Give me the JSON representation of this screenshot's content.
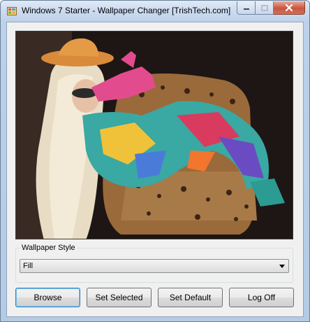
{
  "window": {
    "title": "Windows 7 Starter - Wallpaper Changer [TrishTech.com]"
  },
  "preview": {
    "alt": "Wallpaper preview"
  },
  "style_group": {
    "label": "Wallpaper Style",
    "selected": "Fill"
  },
  "buttons": {
    "browse": "Browse",
    "set_selected": "Set Selected",
    "set_default": "Set Default",
    "log_off": "Log Off"
  },
  "colors": {
    "accent": "#3c7fb1",
    "close_button": "#c8553f"
  }
}
